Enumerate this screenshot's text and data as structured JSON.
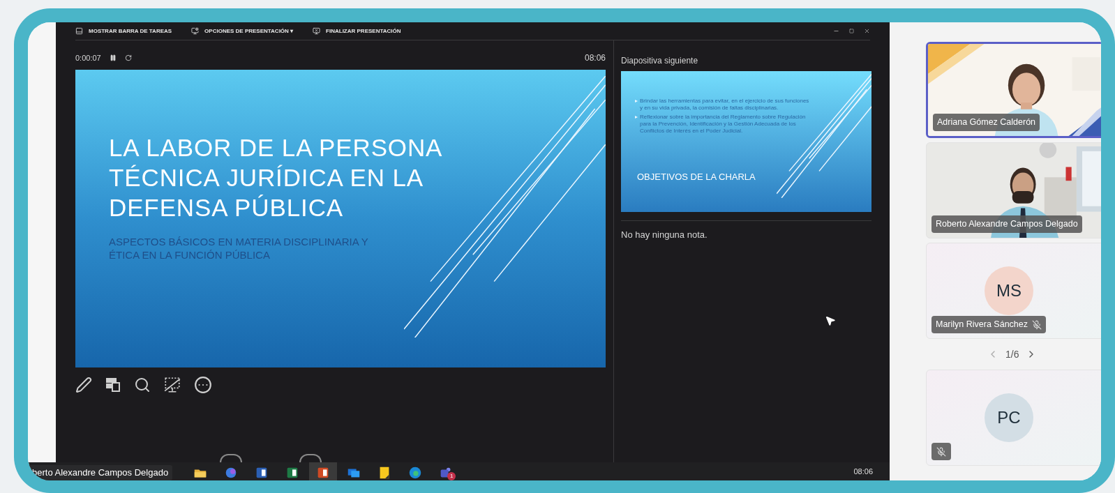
{
  "toolbar": {
    "items": [
      "MOSTRAR BARRA DE TAREAS",
      "OPCIONES DE PRESENTACIÓN ▾",
      "FINALIZAR PRESENTACIÓN"
    ]
  },
  "timer": {
    "elapsed": "0:00:07",
    "clock": "08:06"
  },
  "slide": {
    "title": "LA LABOR DE LA PERSONA TÉCNICA JURÍDICA EN LA DEFENSA PÚBLICA",
    "subtitle": "ASPECTOS BÁSICOS EN MATERIA DISCIPLINARIA Y ÉTICA EN LA FUNCIÓN PÚBLICA"
  },
  "next_slide": {
    "heading": "Diapositiva siguiente",
    "bullets": [
      "Brindar las herramientas para evitar, en el ejercicio de sus funciones y en su vida privada, la comisión de faltas disciplinarias.",
      "Reflexionar sobre la importancia del Reglamento sobre Regulación para la Prevención, Identificación y la Gestión Adecuada de los Conflictos de Interés en el Poder Judicial."
    ],
    "title": "OBJETIVOS DE LA CHARLA"
  },
  "notes": "No hay ninguna nota.",
  "participants": [
    {
      "kind": "video",
      "name": "Adriana Gómez Calderón",
      "selected": true,
      "muted": false
    },
    {
      "kind": "video",
      "name": "Roberto Alexandre Campos Delgado",
      "selected": false,
      "muted": false
    },
    {
      "kind": "avatar",
      "initials": "MS",
      "color": "#f3d5cb",
      "name": "Marilyn Rivera Sánchez",
      "selected": false,
      "muted": true
    }
  ],
  "pager": "1/6",
  "more_participants": [
    {
      "kind": "avatar",
      "initials": "PC",
      "color": "#d3dee5",
      "selected": false,
      "muted": true
    }
  ],
  "taskbar": {
    "caption": "berto Alexandre Campos Delgado",
    "apps": [
      {
        "kind": "folder",
        "selected": false
      },
      {
        "kind": "copilot",
        "selected": false
      },
      {
        "kind": "word",
        "selected": false
      },
      {
        "kind": "excel",
        "selected": false
      },
      {
        "kind": "powerpoint",
        "selected": true
      },
      {
        "kind": "remote",
        "selected": false
      },
      {
        "kind": "notes",
        "selected": false
      },
      {
        "kind": "edge",
        "selected": false
      },
      {
        "kind": "teams",
        "selected": false,
        "badge": "1"
      }
    ],
    "time": "08:06"
  }
}
